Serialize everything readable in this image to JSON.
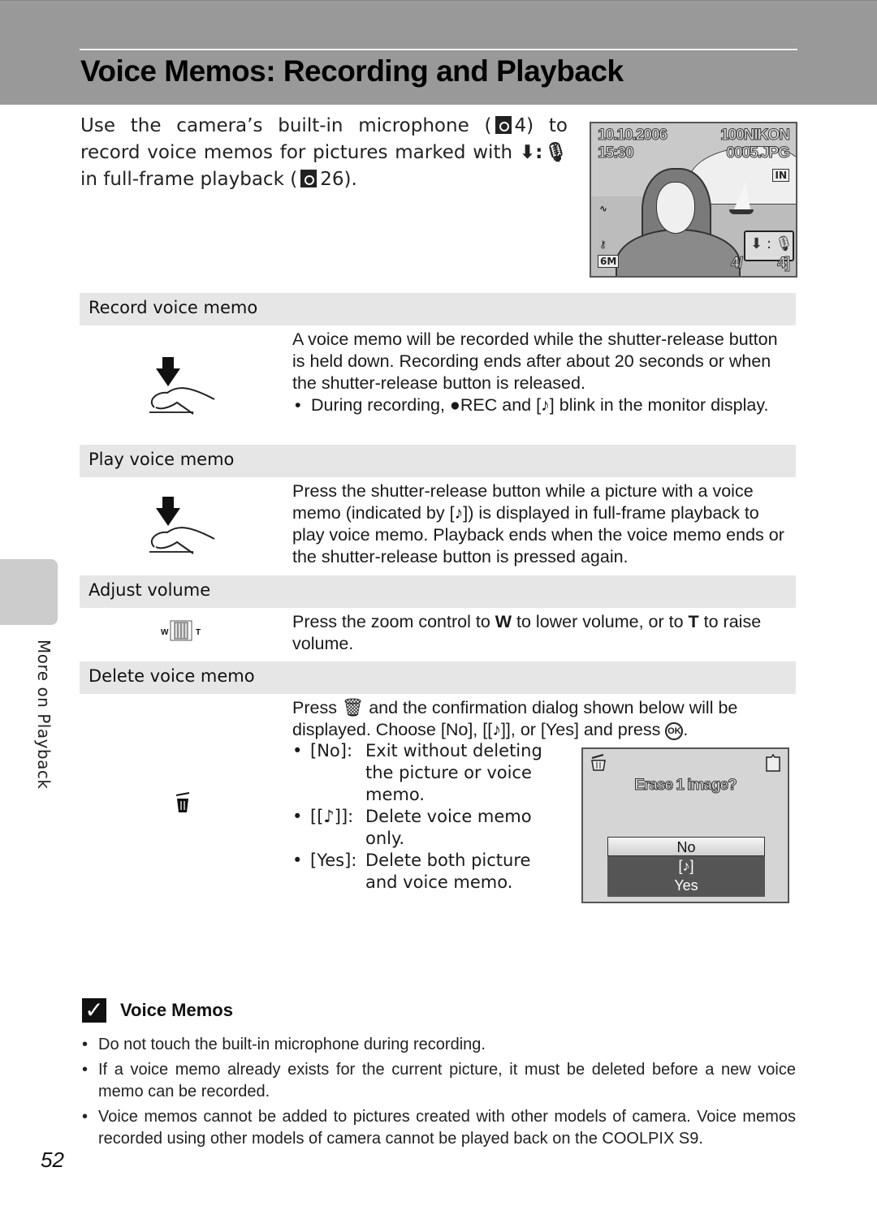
{
  "header": {
    "title": "Voice Memos: Recording and Playback"
  },
  "intro": {
    "part1": "Use the camera’s built-in microphone (",
    "ref1": "4",
    "part2": ") to record voice memos for pictures marked with ",
    "voice_mark": "⬇:🎙",
    "part3": " in full-frame playback (",
    "ref2": "26",
    "part4": ")."
  },
  "camera_screen": {
    "date": "10.10.2006",
    "time": "15:30",
    "folder": "100NIKON",
    "file": "0005.JPG",
    "memory": "IN",
    "image_mode": "6M",
    "frame_counter": "4/",
    "total": "4]",
    "icons": [
      "battery-icon",
      "protect-key-icon",
      "voice-memo-available-icon",
      "internal-memory-icon"
    ]
  },
  "sections": [
    {
      "heading": "Record voice memo",
      "icon": "shutter-press-icon",
      "text": "A voice memo will be recorded while the shutter-release button is held down. Recording ends after about 20 seconds or when the shutter-release button is released.",
      "bullets": [
        "During recording, ●REC and [♪] blink in the monitor display."
      ]
    },
    {
      "heading": "Play voice memo",
      "icon": "shutter-press-icon",
      "text": "Press the shutter-release button while a picture with a voice memo (indicated by [♪]) is displayed in full-frame playback to play voice memo. Playback ends when the voice memo ends or the shutter-release button is pressed again.",
      "bullets": []
    },
    {
      "heading": "Adjust volume",
      "icon": "zoom-control-icon",
      "text_part1": "Press the zoom control to ",
      "key_w": "W",
      "text_part2": " to lower volume, or to ",
      "key_t": "T",
      "text_part3": " to raise volume.",
      "zoom_w": "W",
      "zoom_t": "T"
    },
    {
      "heading": "Delete voice memo",
      "icon": "trash-icon",
      "text_part1": "Press ",
      "text_part2": " and the confirmation dialog shown below will be displayed. Choose [No], [[♪]], or [Yes] and press ",
      "ok_symbol": "OK",
      "text_part3": ".",
      "options": [
        {
          "key": "[No]:",
          "text": "Exit without deleting the picture or voice memo."
        },
        {
          "key": "[[♪]]:",
          "text": "Delete voice memo only."
        },
        {
          "key": "[Yes]:",
          "text": "Delete both picture and voice memo."
        }
      ]
    }
  ],
  "dialog": {
    "title": "Erase 1 image?",
    "options": [
      "No",
      "[♪]",
      "Yes"
    ],
    "selected": "No"
  },
  "side_tab": {
    "label": "More on Playback"
  },
  "note": {
    "title": "Voice Memos",
    "items": [
      "Do not touch the built-in microphone during recording.",
      "If a voice memo already exists for the current picture, it must be deleted before a new voice memo can be recorded.",
      "Voice memos cannot be added to pictures created with other models of camera. Voice memos recorded using other models of camera cannot be played back on the COOLPIX S9."
    ]
  },
  "page_number": "52"
}
